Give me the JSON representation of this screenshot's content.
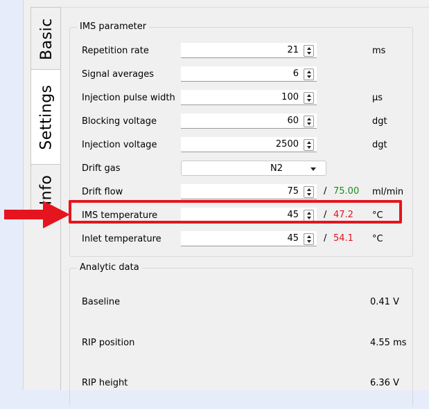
{
  "tabs": [
    {
      "label": "Basic",
      "active": false
    },
    {
      "label": "Settings",
      "active": true
    },
    {
      "label": "Info",
      "active": false
    }
  ],
  "ims_group": {
    "title": "IMS parameter",
    "rows": [
      {
        "label": "Repetition rate",
        "value": "21",
        "unit": "ms"
      },
      {
        "label": "Signal averages",
        "value": "6",
        "unit": ""
      },
      {
        "label": "Injection pulse width",
        "value": "100",
        "unit": "µs"
      },
      {
        "label": "Blocking voltage",
        "value": "60",
        "unit": "dgt"
      },
      {
        "label": "Injection voltage",
        "value": "2500",
        "unit": "dgt"
      },
      {
        "label": "Drift gas",
        "value": "N2",
        "unit": ""
      },
      {
        "label": "Drift flow",
        "value": "75",
        "separator": "/",
        "actual": "75.00",
        "actual_color": "#1c8a1c",
        "unit": "ml/min"
      },
      {
        "label": "IMS temperature",
        "value": "45",
        "separator": "/",
        "actual": "47.2",
        "actual_color": "#e0141e",
        "unit": "°C"
      },
      {
        "label": "Inlet temperature",
        "value": "45",
        "separator": "/",
        "actual": "54.1",
        "actual_color": "#e0141e",
        "unit": "°C"
      }
    ]
  },
  "analytic_group": {
    "title": "Analytic data",
    "rows": [
      {
        "label": "Baseline",
        "value": "0.41  V"
      },
      {
        "label": "RIP position",
        "value": "4.55  ms"
      },
      {
        "label": "RIP height",
        "value": "6.36  V"
      }
    ]
  },
  "annotation": {
    "highlight_color": "#e6141e",
    "highlighted_row": "IMS temperature"
  }
}
